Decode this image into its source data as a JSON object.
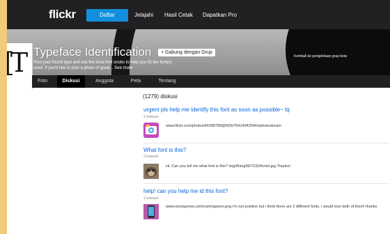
{
  "nav": {
    "logo": "flickr",
    "signup_label": "Daftar",
    "links": [
      "Jelajahi",
      "Hasil Cetak",
      "Dapatkan Pro"
    ]
  },
  "group": {
    "back_link": "Kembali ke pengelolaan grup beta",
    "title": "Typeface Identification",
    "join_label": "+ Gabung dengan Grup",
    "desc_line1": "Post your found type and ask the local font snobs to help you ID the font(s)",
    "desc_line2": "used. If you'd like to post a photo of great...",
    "see_more": "See more"
  },
  "tabs": [
    "Foto",
    "Diskusi",
    "Anggota",
    "Peta",
    "Tentang"
  ],
  "active_tab": "Diskusi",
  "discussion_count": "(1279) diskusi",
  "threads": [
    {
      "title": "urgent pls help me identify this font as soon as possible~ tq",
      "replies": "2 balasan",
      "message": "www.flickr.com/photos/64288789@N05/7641494254/in/photostream",
      "thumb_icon": "camera-app-icon"
    },
    {
      "title": "What font is this?",
      "replies": "2 balasan",
      "message": "Hi, Can you tell me what font is this? img99img99/7232/fontst.jpg Thanks!",
      "thumb_icon": "monkey-photo-icon"
    },
    {
      "title": "help! can you help me id this font?",
      "replies": "1 balasan",
      "message": "www.nicolajones.com/comingsoon.png i'm not positive but i think there are 2 different fonts. i would love both of them! thanks",
      "thumb_icon": "phone-photo-icon"
    }
  ],
  "colors": {
    "page_border": "#f3c97a",
    "nav_bg": "#212124",
    "accent": "#128fdc",
    "link": "#0063dc"
  }
}
